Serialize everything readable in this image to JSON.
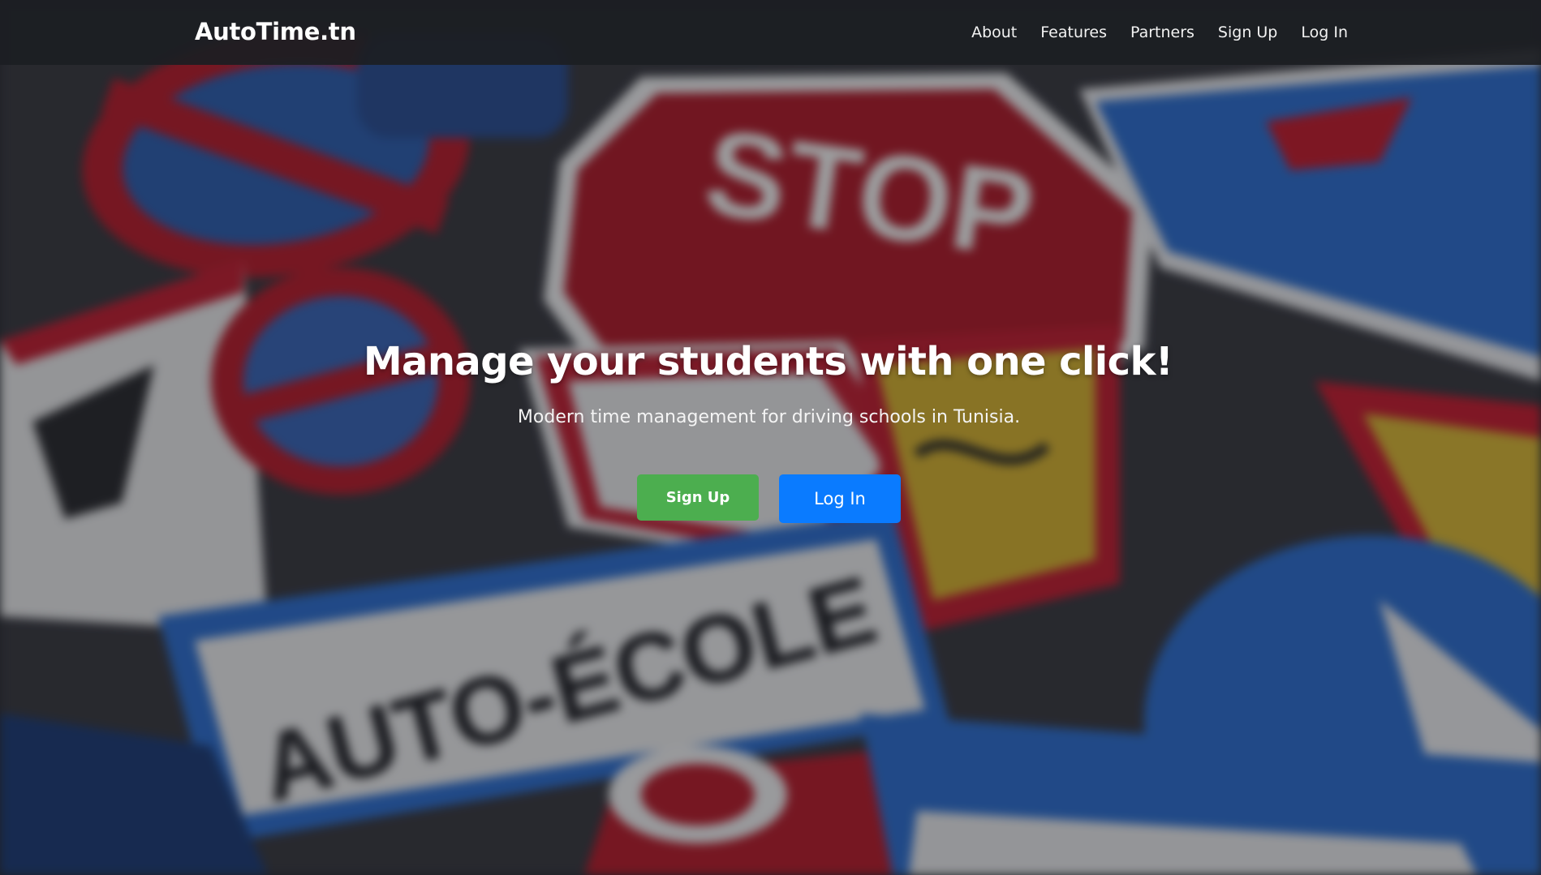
{
  "navbar": {
    "brand": "AutoTime.tn",
    "links": [
      "About",
      "Features",
      "Partners",
      "Sign Up",
      "Log In"
    ]
  },
  "hero": {
    "headline": "Manage your students with one click!",
    "subline": "Modern time management for driving schools in Tunisia.",
    "signup_label": "Sign Up",
    "login_label": "Log In",
    "background_sign_texts": [
      "STOP",
      "AUTO-ÉCOLE"
    ]
  },
  "colors": {
    "signup_button": "#4cae4f",
    "login_button": "#0a7bff",
    "navbar_bg": "#1c1e22",
    "sign_red": "#b81e2e",
    "sign_blue": "#2f6fd0"
  }
}
